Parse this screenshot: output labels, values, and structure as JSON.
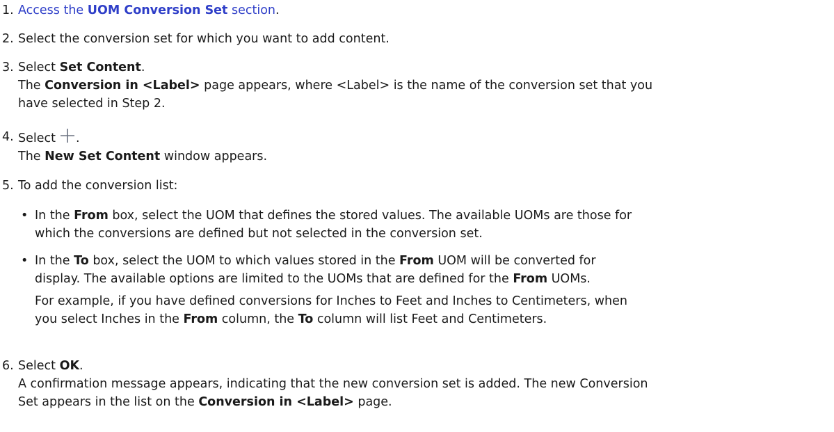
{
  "steps": [
    {
      "num": "1.",
      "pre": "Access the ",
      "bold": "UOM Conversion Set",
      "post": " section",
      "tail": "."
    },
    {
      "num": "2.",
      "text": "Select the conversion set for which you want to add content."
    },
    {
      "num": "3.",
      "pre": "Select ",
      "bold": "Set Content",
      "post": ".",
      "result_pre": "The ",
      "result_bold": "Conversion in <Label>",
      "result_post_1": " page appears, where <Label> is the name of the conversion set that you",
      "result_post_2": "have selected in Step 2."
    },
    {
      "num": "4.",
      "pre": "Select",
      "icon": "plus-icon",
      "post": ".",
      "result_pre": "The ",
      "result_bold": "New Set Content",
      "result_post": " window appears."
    },
    {
      "num": "5.",
      "text": "To add the conversion list:",
      "bullets": [
        {
          "pre": "In the ",
          "bold": "From",
          "post_1": " box, select the UOM that defines the stored values. The available UOMs are those for",
          "line2": "which the conversions are defined but not selected in the conversion set."
        },
        {
          "pre": "In the ",
          "bold": "To",
          "mid": " box, select the UOM to which values stored in the ",
          "bold2": "From",
          "post_1": " UOM will be converted for",
          "line2_pre": "display. The available options are limited to the UOMs that are defined for the ",
          "line2_bold": "From",
          "line2_post": " UOMs.",
          "example_1": "For example, if you have defined conversions for Inches to Feet and Inches to Centimeters, when",
          "example_2_pre": "you select Inches in the ",
          "example_2_bold": "From",
          "example_2_mid": " column, the ",
          "example_2_bold2": "To",
          "example_2_post": " column will list Feet and Centimeters."
        }
      ]
    },
    {
      "num": "6.",
      "pre": "Select ",
      "bold": "OK",
      "post": ".",
      "result_1": "A confirmation message appears, indicating that the new conversion set is added. The new Conversion",
      "result_2_pre": "Set appears in the list on the ",
      "result_2_bold": "Conversion in <Label>",
      "result_2_post": " page."
    }
  ],
  "bullet_char": "•",
  "colors": {
    "text": "#1a1a1a",
    "link": "#2e3ec8",
    "icon": "#6b7280"
  }
}
